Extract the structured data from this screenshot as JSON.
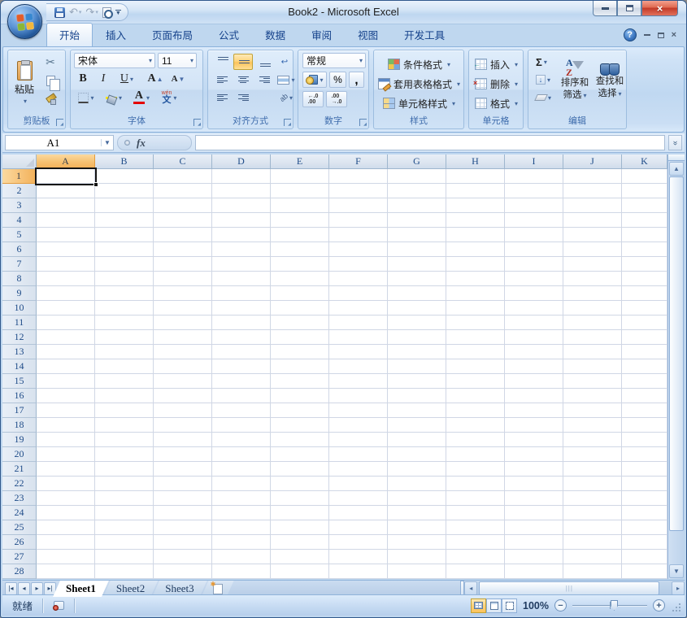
{
  "window": {
    "title": "Book2 - Microsoft Excel"
  },
  "icons": {
    "office_logo": "office-orb-four-squares",
    "save": "floppy-disk",
    "undo": "↶",
    "redo": "↷",
    "print_preview": "page-with-magnifier",
    "help": "?",
    "dropdown": "▾",
    "minimize": "—",
    "restore": "window-restore",
    "close": "×"
  },
  "ribbon_tabs": [
    {
      "id": "home",
      "label": "开始",
      "active": true
    },
    {
      "id": "insert",
      "label": "插入",
      "active": false
    },
    {
      "id": "page-layout",
      "label": "页面布局",
      "active": false
    },
    {
      "id": "formulas",
      "label": "公式",
      "active": false
    },
    {
      "id": "data",
      "label": "数据",
      "active": false
    },
    {
      "id": "review",
      "label": "审阅",
      "active": false
    },
    {
      "id": "view",
      "label": "视图",
      "active": false
    },
    {
      "id": "developer",
      "label": "开发工具",
      "active": false
    }
  ],
  "ribbon": {
    "clipboard": {
      "label": "剪贴板",
      "paste": "粘贴"
    },
    "font": {
      "label": "字体",
      "family": "宋体",
      "size": "11",
      "bold": "B",
      "italic": "I",
      "underline": "U",
      "grow": "A",
      "shrink": "A",
      "phonetic": "文",
      "phonetic_pinyin": "wén"
    },
    "alignment": {
      "label": "对齐方式",
      "orientation": "ab",
      "wrap": "↩"
    },
    "number": {
      "label": "数字",
      "format": "常规",
      "percent": "%",
      "comma": ",",
      "inc_top": "←.0",
      "inc_bottom": ".00",
      "dec_top": ".00",
      "dec_bottom": "→.0"
    },
    "styles": {
      "label": "样式",
      "conditional": "条件格式",
      "format_table": "套用表格格式",
      "cell_styles": "单元格样式"
    },
    "cells": {
      "label": "单元格",
      "insert": "插入",
      "delete": "删除",
      "format": "格式"
    },
    "editing": {
      "label": "编辑",
      "autosum": "Σ",
      "fill": "↓",
      "sort_line1": "排序和",
      "sort_line2": "筛选",
      "find_line1": "查找和",
      "find_line2": "选择",
      "sort_a": "A",
      "sort_z": "Z"
    }
  },
  "formula_bar": {
    "name_box": "A1",
    "fx": "fx",
    "value": "",
    "expand": "»"
  },
  "grid": {
    "columns": [
      "A",
      "B",
      "C",
      "D",
      "E",
      "F",
      "G",
      "H",
      "I",
      "J",
      "K"
    ],
    "row_count": 28,
    "selected_cell": "A1",
    "selected_column": "A",
    "selected_row": "1"
  },
  "sheet_tabs": [
    {
      "id": "sheet1",
      "label": "Sheet1",
      "active": true
    },
    {
      "id": "sheet2",
      "label": "Sheet2",
      "active": false
    },
    {
      "id": "sheet3",
      "label": "Sheet3",
      "active": false
    }
  ],
  "status_bar": {
    "ready": "就绪",
    "zoom_level": "100%"
  }
}
